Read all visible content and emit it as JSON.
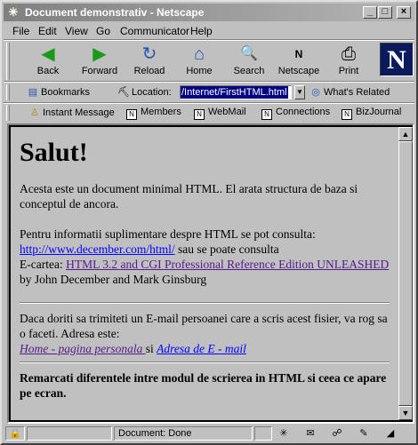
{
  "window": {
    "title": "Document demonstrativ - Netscape"
  },
  "menu": [
    "File",
    "Edit",
    "View",
    "Go",
    "Communicator",
    "Help"
  ],
  "nav": [
    {
      "label": "Back",
      "icon": "back-arrow-icon",
      "glyph": "◀"
    },
    {
      "label": "Forward",
      "icon": "forward-arrow-icon",
      "glyph": "▶"
    },
    {
      "label": "Reload",
      "icon": "reload-icon",
      "glyph": "↻"
    },
    {
      "label": "Home",
      "icon": "home-icon",
      "glyph": "⌂"
    },
    {
      "label": "Search",
      "icon": "search-icon",
      "glyph": "🔍"
    },
    {
      "label": "Netscape",
      "icon": "netscape-icon",
      "glyph": "N"
    },
    {
      "label": "Print",
      "icon": "printer-icon",
      "glyph": "⎙"
    }
  ],
  "location": {
    "bookmarks_label": "Bookmarks",
    "location_label": "Location:",
    "url": "/Internet/FirstHTML.html",
    "whats_related": "What's Related"
  },
  "personal_bar": {
    "instant_message": "Instant Message",
    "members": "Members",
    "webmail": "WebMail",
    "connections": "Connections",
    "bizjournal": "BizJournal"
  },
  "content": {
    "heading": "Salut!",
    "p1": "Acesta este un document minimal HTML. El arata structura de baza si conceptul de ancora.",
    "p2_intro": "Pentru informatii suplimentare despre HTML se pot consulta:",
    "p2_link": "http://www.december.com/html/",
    "p2_after_link": " sau se poate consulta",
    "p2_ecartea": "E-cartea: ",
    "p2_book_link": "HTML 3.2 and CGI Professional Reference Edition UNLEASHED",
    "p2_authors": " by John December and Mark Ginsburg",
    "p3": "Daca doriti sa trimiteti un E-mail persoanei care a scris acest fisier, va rog sa o faceti. Adresa este:",
    "home_link": "Home - pagina personala ",
    "si": " si ",
    "email_link": "Adresa de E - mail ",
    "closing": "Remarcati diferentele intre modul de scrierea in HTML si ceea ce apare pe ecran."
  },
  "status": {
    "text": "Document: Done"
  }
}
